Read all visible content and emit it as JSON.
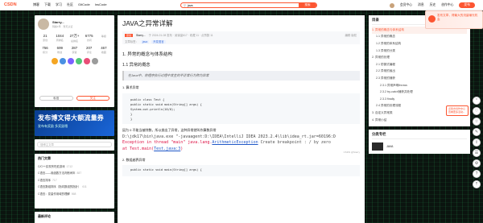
{
  "topbar": {
    "logo": "CSDN",
    "nav": [
      "博客",
      "下载",
      "学习",
      "社区",
      "GitCode",
      "InsCode"
    ],
    "search_value": "java",
    "search_button": "搜索",
    "right": [
      "会员中心",
      "消息",
      "历史",
      "创作中心"
    ],
    "publish": "发布"
  },
  "promo": {
    "text": "发布文章，得最大的流量曝光机会"
  },
  "profile": {
    "name": "Starry...",
    "sub": "码龄1年 · 暂无认证",
    "stats1": [
      {
        "num": "21",
        "label": "原创"
      },
      {
        "num": "1044",
        "label": "周排名"
      },
      {
        "num": "27万+",
        "label": "总排名"
      },
      {
        "num": "6775",
        "label": "访问"
      },
      {
        "num": "",
        "label": "等级"
      }
    ],
    "stats2": [
      {
        "num": "756",
        "label": "积分"
      },
      {
        "num": "699",
        "label": "粉丝"
      },
      {
        "num": "287",
        "label": "获赞"
      },
      {
        "num": "207",
        "label": "评论"
      },
      {
        "num": "467",
        "label": "收藏"
      }
    ],
    "chat": "私信",
    "follow": "关注"
  },
  "ad": {
    "line1": "发布博文得大额流量券",
    "line2": "发布有奖励 多奖励哦"
  },
  "left_search": {
    "placeholder": "搜博主文章"
  },
  "hot": {
    "title": "热门文章",
    "items": [
      {
        "t": "C/C++实现贪吃蛇游戏",
        "n": "1712"
      },
      {
        "t": "C语言——用函数方法判断闰年",
        "n": "887"
      },
      {
        "t": "C语言排序",
        "n": "717"
      },
      {
        "t": "C语言数组排序（指向数组的指针）",
        "n": "611"
      },
      {
        "t": "C语言：变量作用域的理解",
        "n": "568"
      }
    ]
  },
  "recent": {
    "title": "最新评论"
  },
  "article": {
    "title": "JAVA之异常详解",
    "original": "原创",
    "author": "Starry...",
    "meta_info": "于 2024-01-08 发布 · 阅读量617 · 收藏 11 · 点赞数 11",
    "tags_label": "文章标签：",
    "tags": [
      "java",
      "开发语言"
    ],
    "edit": "编辑 版权",
    "h1": "1. 异常的概念与体系结构",
    "h2": "1.1 异常的概念",
    "quote": "在Java中，将程序执行过程中发生的不正常行为称为异常",
    "p1": "1. 算术异常",
    "code1": [
      "public class Test {",
      "    public static void main(String[] args) {",
      "        System.out.println(10/0);",
      "    }",
      "}"
    ],
    "p2": "因为 0 不能当被除数，所以抛出了异常，这种异常就叫作算数异常",
    "console1": "D:\\jdk17\\bin\\java.exe \"-javaagent:D:\\IDEA\\IntelliJ IDEA 2023.2.4\\lib\\idea_rt.jar=60196:D",
    "console2a": "Exception in thread \"main\" java.lang.",
    "console2b": "ArithmeticException",
    "console2c": " Create breakpoint : / by zero",
    "console3a": "    at Test.main(",
    "console3b": "Test.java:3",
    "console3c": ")",
    "watermark": "CSDN @Starry",
    "p3": "2. 数组越界异常",
    "code2": "public static void main(String[] args) {"
  },
  "toc": {
    "title": "目录",
    "items": [
      {
        "t": "1. 异常的概念与体系结构",
        "lvl": 1,
        "active": true
      },
      {
        "t": "1.1 异常的概念",
        "lvl": 2
      },
      {
        "t": "1.2 异常的体系结构",
        "lvl": 2
      },
      {
        "t": "1.3 异常的分类",
        "lvl": 2
      },
      {
        "t": "2. 异常的处理",
        "lvl": 1
      },
      {
        "t": "2.1 防御式编程",
        "lvl": 2
      },
      {
        "t": "2.2 异常的抛出",
        "lvl": 2
      },
      {
        "t": "2.3 异常的捕获",
        "lvl": 2
      },
      {
        "t": "2.3.1 异常声明throws",
        "lvl": 3
      },
      {
        "t": "2.3.2 try-catch捕获并处理",
        "lvl": 3
      },
      {
        "t": "2.3.3 finally",
        "lvl": 3
      },
      {
        "t": "2.4 异常的处理流程",
        "lvl": 2
      },
      {
        "t": "3. 自定义异常类",
        "lvl": 1
      },
      {
        "t": "4. 异常小结",
        "lvl": 1
      }
    ],
    "notice": "点我去创作中心查看更多活动~"
  },
  "column": {
    "title": "分类专栏",
    "item": "JAVA"
  },
  "floatbar": [
    "⌃",
    "♡",
    "☆",
    "✎",
    "⇪",
    "☰",
    "⚙",
    "?",
    "⤒"
  ],
  "colors": {
    "accent": "#fc5531"
  }
}
